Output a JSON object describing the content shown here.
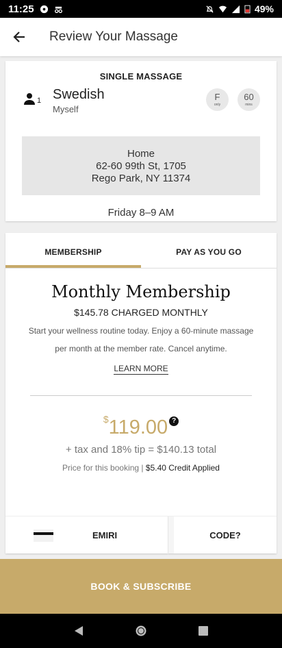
{
  "status_bar": {
    "time": "11:25",
    "battery": "49%"
  },
  "header": {
    "title": "Review Your Massage"
  },
  "booking": {
    "section_title": "SINGLE MASSAGE",
    "person_count": "1",
    "service": "Swedish",
    "recipient": "Myself",
    "gender_pill": {
      "big": "F",
      "small": "only"
    },
    "duration_pill": {
      "big": "60",
      "small": "mins"
    },
    "address": {
      "line1": "Home",
      "line2": "62-60 99th St, 1705",
      "line3": "Rego Park, NY 11374"
    },
    "time": "Friday 8–9 AM"
  },
  "tabs": [
    {
      "label": "MEMBERSHIP",
      "active": true
    },
    {
      "label": "PAY AS YOU GO",
      "active": false
    }
  ],
  "membership": {
    "name": "Monthly Membership",
    "charge": "$145.78 CHARGED MONTHLY",
    "description": "Start your wellness routine today. Enjoy a 60-minute massage per month at the member rate. Cancel anytime.",
    "learn_more": "LEARN MORE"
  },
  "pricing": {
    "currency": "$",
    "amount": "119.00",
    "help_glyph": "?",
    "total_line": "+ tax and 18% tip = $140.13 total",
    "note": "Price for this booking |",
    "credit": "$5.40 Credit Applied"
  },
  "payment": {
    "card_label": "EMIRI",
    "code_label": "CODE?"
  },
  "cta": {
    "label": "BOOK & SUBSCRIBE"
  },
  "colors": {
    "accent": "#c7aa6a",
    "statusbar": "#000000"
  },
  "icons": [
    "back-arrow-icon",
    "person-icon",
    "help-icon",
    "credit-card-icon",
    "nav-back-icon",
    "nav-home-icon",
    "nav-recents-icon"
  ]
}
